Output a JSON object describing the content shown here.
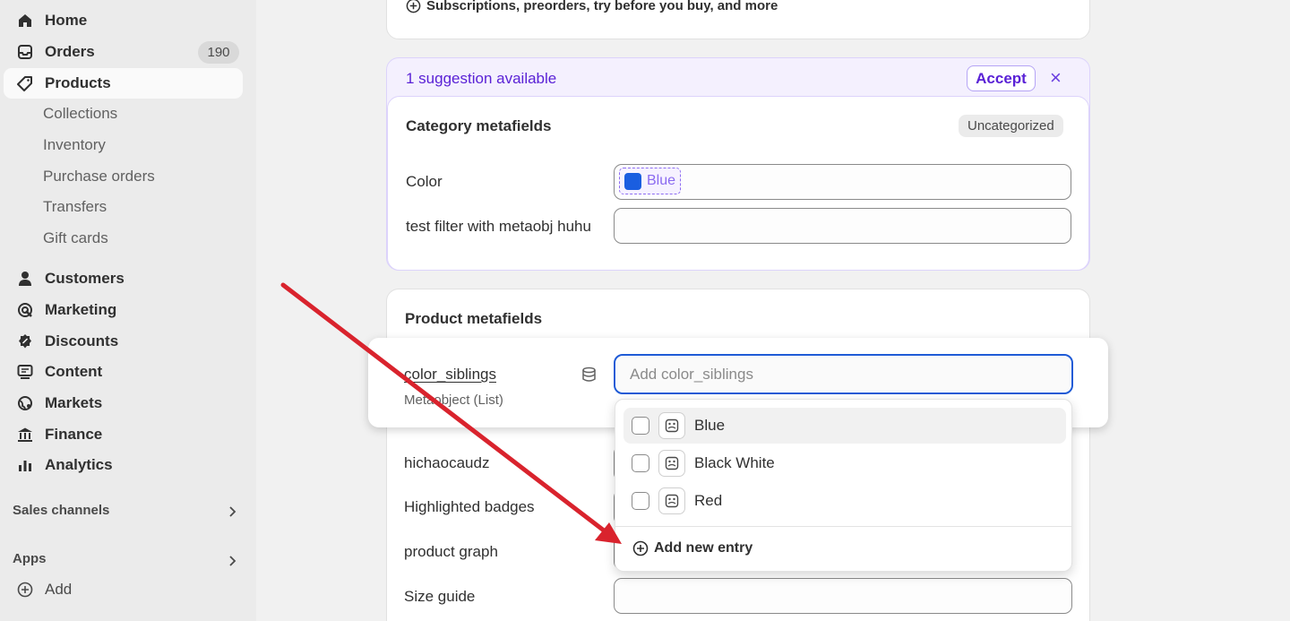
{
  "sidebar": {
    "home": "Home",
    "orders": "Orders",
    "orders_count": "190",
    "products": "Products",
    "sub_items": [
      "Collections",
      "Inventory",
      "Purchase orders",
      "Transfers",
      "Gift cards"
    ],
    "customers": "Customers",
    "marketing": "Marketing",
    "discounts": "Discounts",
    "content": "Content",
    "markets": "Markets",
    "finance": "Finance",
    "analytics": "Analytics",
    "sales_channels": "Sales channels",
    "apps": "Apps",
    "add": "Add"
  },
  "top_card": {
    "subscriptions_text": "Subscriptions, preorders, try before you buy, and more"
  },
  "suggestion": {
    "text": "1 suggestion available",
    "accept": "Accept",
    "dismiss": "×"
  },
  "category_metafields": {
    "title": "Category metafields",
    "badge": "Uncategorized",
    "color_label": "Color",
    "color_value": "Blue",
    "test_filter_label": "test filter with metaobj huhu"
  },
  "product_metafields": {
    "title": "Product metafields",
    "color_siblings_label": "color_siblings",
    "color_siblings_type": "Metaobject (List)",
    "color_siblings_placeholder": "Add color_siblings",
    "options": [
      "Blue",
      "Black White",
      "Red"
    ],
    "add_new_entry": "Add new entry",
    "hichaocaudz": "hichaocaudz",
    "highlighted_badges": "Highlighted badges",
    "product_graph": "product graph",
    "size_guide": "Size guide"
  },
  "colors": {
    "accent_purple": "#5a22d6",
    "swatch_blue": "#1a5ee0",
    "focus_blue": "#1f5bd6",
    "arrow_red": "#d9232d"
  }
}
